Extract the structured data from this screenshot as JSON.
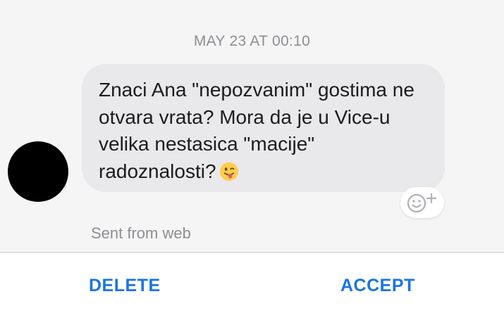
{
  "conversation": {
    "timestamp": "MAY 23 AT 00:10",
    "message": {
      "text": "Znaci Ana \"nepozvanim\" gostima ne otvara vrata? Mora da je u Vice-u velika nestasica \"macije\" radoznalosti?",
      "emoji": "face-with-tongue-emoji"
    },
    "sent_from": "Sent from web",
    "reaction_icon": "smiley-plus-icon"
  },
  "actions": {
    "delete_label": "DELETE",
    "accept_label": "ACCEPT"
  },
  "colors": {
    "accent": "#1a73e8",
    "bubble": "#e9e9eb",
    "chat_background": "#f5f5f5",
    "meta_text": "#8e8e93"
  }
}
